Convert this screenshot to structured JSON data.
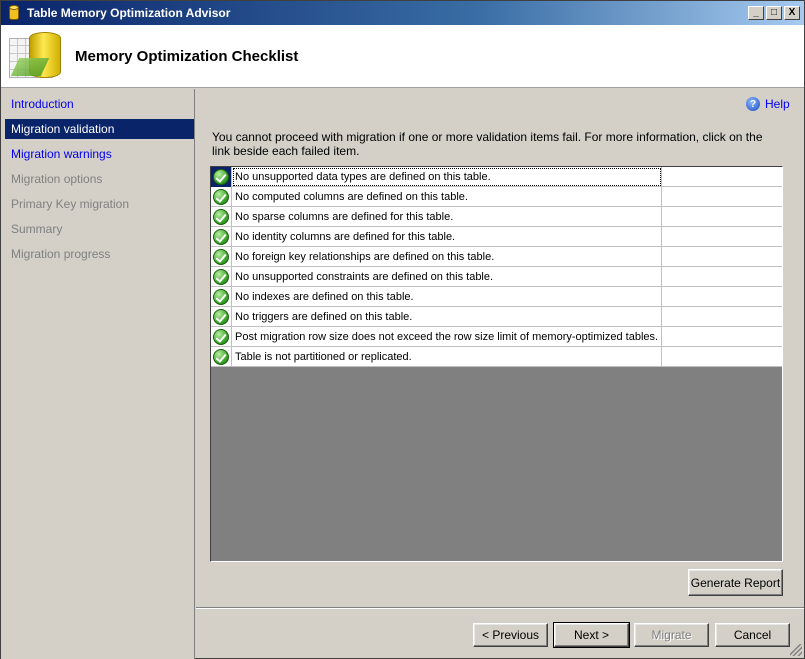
{
  "window": {
    "title": "Table Memory Optimization Advisor",
    "controls": {
      "minimize": "_",
      "maximize": "□",
      "close": "X"
    }
  },
  "header": {
    "title": "Memory Optimization Checklist",
    "icon": "memory-optimization-icon"
  },
  "nav": {
    "items": [
      {
        "label": "Introduction",
        "state": "link"
      },
      {
        "label": "Migration validation",
        "state": "selected"
      },
      {
        "label": "Migration warnings",
        "state": "link"
      },
      {
        "label": "Migration options",
        "state": "disabled"
      },
      {
        "label": "Primary Key migration",
        "state": "disabled"
      },
      {
        "label": "Summary",
        "state": "disabled"
      },
      {
        "label": "Migration progress",
        "state": "disabled"
      }
    ]
  },
  "main": {
    "help_label": "Help",
    "info_text": "You cannot proceed with migration if one or more validation items fail. For more information, click on the link beside each failed item.",
    "checklist": [
      {
        "status": "passed",
        "text": "No unsupported data types are defined on this table."
      },
      {
        "status": "passed",
        "text": "No computed columns are defined on this table."
      },
      {
        "status": "passed",
        "text": "No sparse columns are defined for this table."
      },
      {
        "status": "passed",
        "text": "No identity columns are defined for this table."
      },
      {
        "status": "passed",
        "text": "No foreign key relationships are defined on this table."
      },
      {
        "status": "passed",
        "text": "No unsupported constraints are defined on this table."
      },
      {
        "status": "passed",
        "text": "No indexes are defined on this table."
      },
      {
        "status": "passed",
        "text": "No triggers are defined on this table."
      },
      {
        "status": "passed",
        "text": "Post migration row size does not exceed the row size limit of memory-optimized tables."
      },
      {
        "status": "passed",
        "text": "Table is not partitioned or replicated."
      }
    ],
    "generate_report_label": "Generate Report"
  },
  "footer": {
    "previous_label": "< Previous",
    "next_label": "Next >",
    "migrate_label": "Migrate",
    "cancel_label": "Cancel"
  }
}
